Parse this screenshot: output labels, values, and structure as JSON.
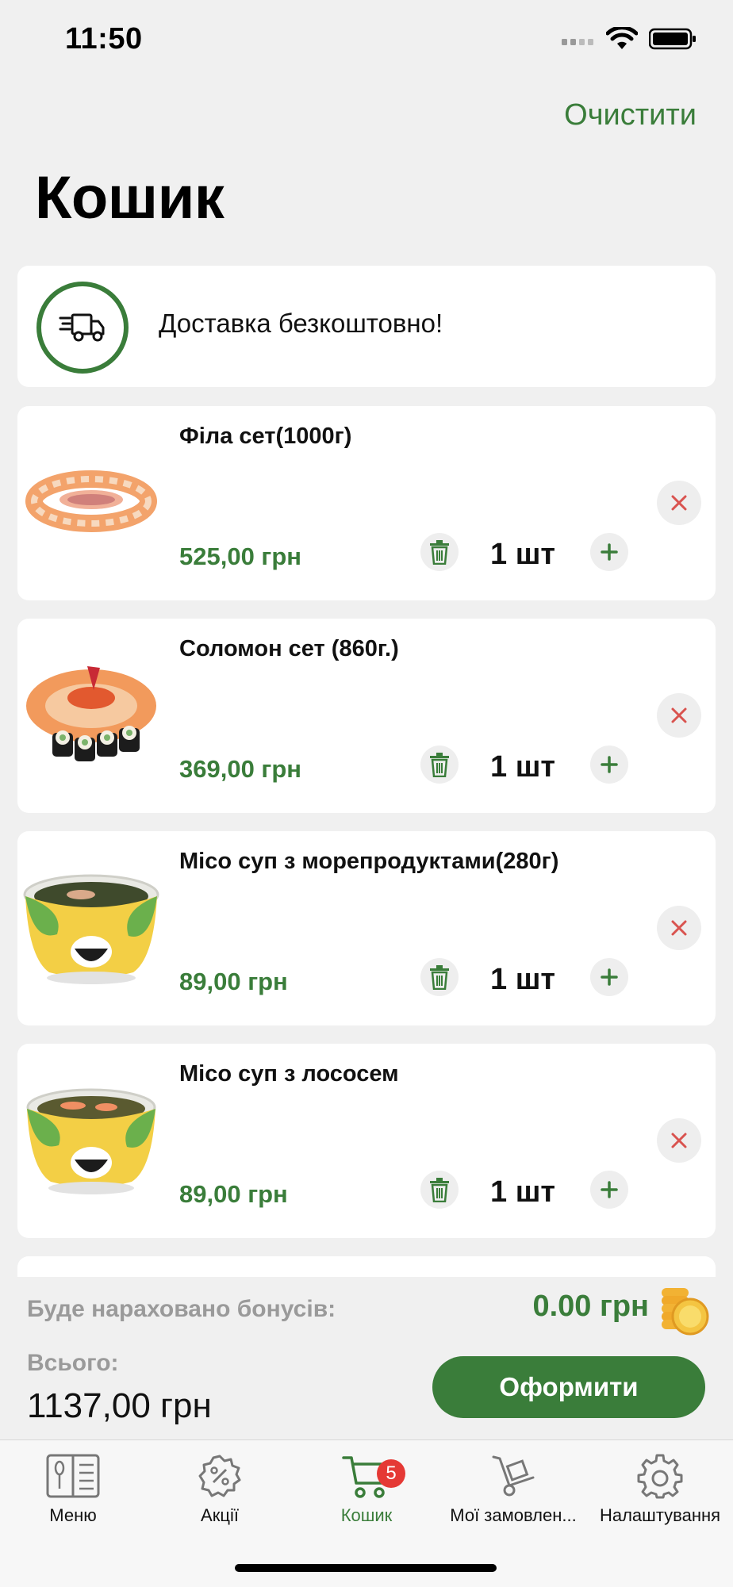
{
  "status_bar": {
    "time": "11:50"
  },
  "header": {
    "clear_label": "Очистити",
    "title": "Кошик"
  },
  "delivery": {
    "text": "Доставка безкоштовно!"
  },
  "items": [
    {
      "name": "Філа сет(1000г)",
      "price": "525,00 грн",
      "qty": "1 шт"
    },
    {
      "name": "Соломон сет (860г.)",
      "price": "369,00 грн",
      "qty": "1 шт"
    },
    {
      "name": "Місо суп з морепродуктами(280г)",
      "price": "89,00 грн",
      "qty": "1 шт"
    },
    {
      "name": "Місо суп з лососем",
      "price": "89,00 грн",
      "qty": "1 шт"
    }
  ],
  "summary": {
    "bonus_label": "Буде нараховано бонусів:",
    "bonus_value": "0.00 грн",
    "total_label": "Всього:",
    "total_value": "1137,00 грн",
    "checkout_label": "Оформити"
  },
  "tabs": [
    {
      "label": "Меню",
      "icon": "menu-book-icon"
    },
    {
      "label": "Акції",
      "icon": "discount-badge-icon"
    },
    {
      "label": "Кошик",
      "icon": "cart-icon",
      "badge": "5",
      "active": true
    },
    {
      "label": "Мої замовлен...",
      "icon": "hand-truck-icon"
    },
    {
      "label": "Налаштування",
      "icon": "gear-icon"
    }
  ],
  "colors": {
    "accent": "#3a7d3a",
    "badge": "#e53935",
    "remove": "#d9534f"
  }
}
